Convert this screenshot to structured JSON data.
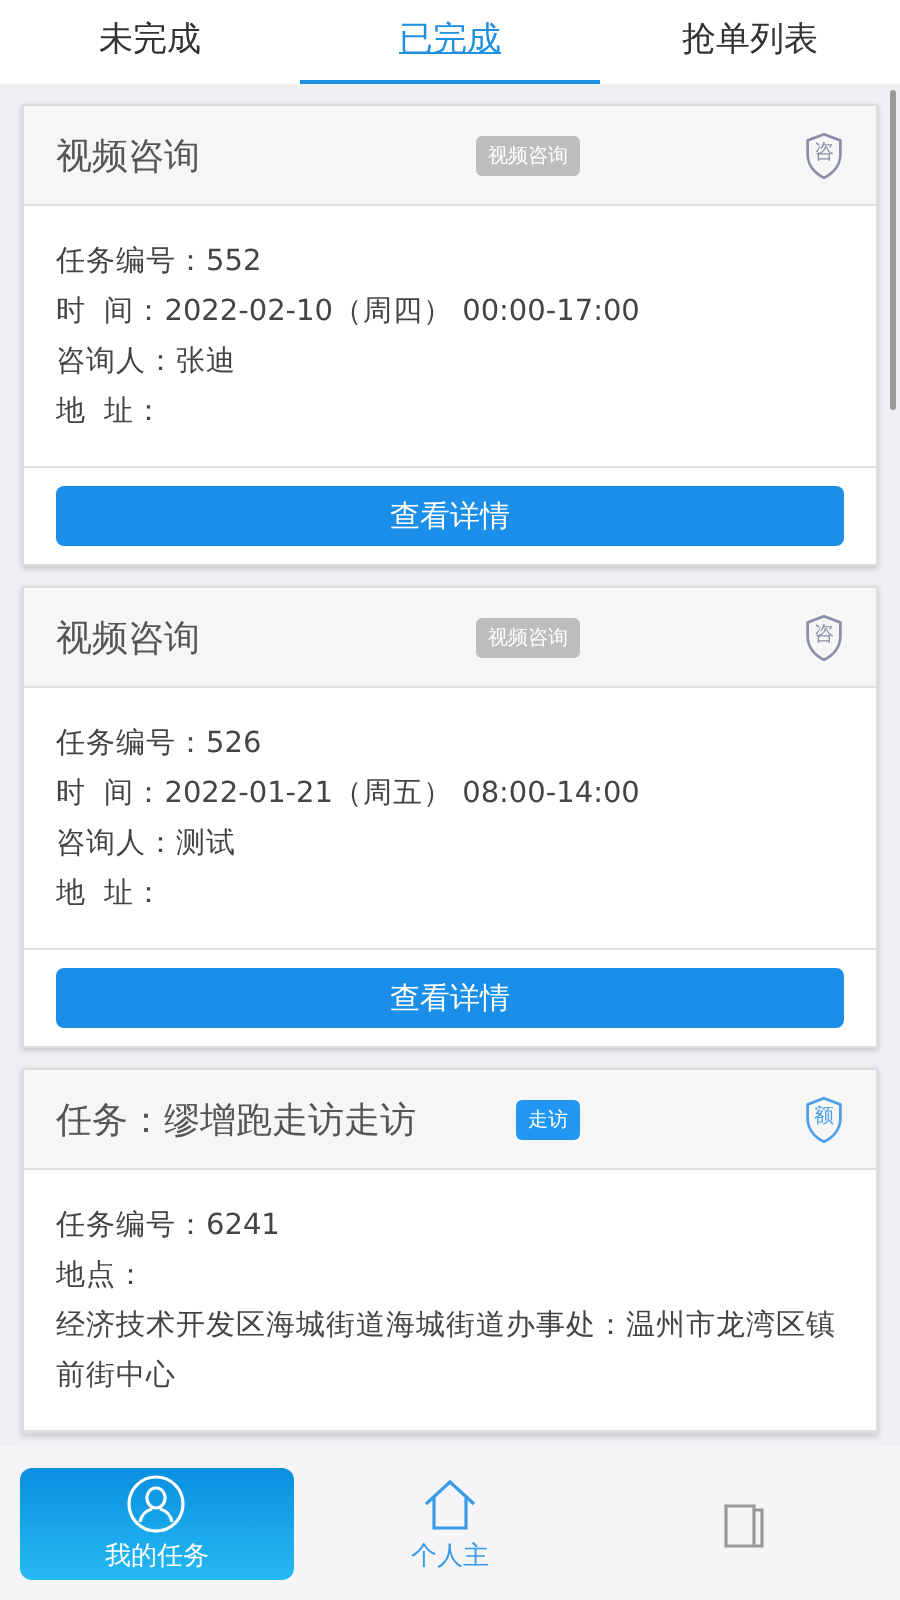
{
  "tabs": [
    {
      "label": "未完成",
      "selected": false
    },
    {
      "label": "已完成",
      "selected": true
    },
    {
      "label": "抢单列表",
      "selected": false
    }
  ],
  "cards": [
    {
      "title": "视频咨询",
      "tag": {
        "text": "视频咨询",
        "color": "#bdbdbd"
      },
      "shield": {
        "char": "咨",
        "color": "#8a8fa8"
      },
      "lines": [
        "任务编号：552",
        "时  间：2022-02-10（周四） 00:00-17:00",
        "咨询人：张迪",
        "地  址："
      ],
      "button": "查看详情"
    },
    {
      "title": "视频咨询",
      "tag": {
        "text": "视频咨询",
        "color": "#bdbdbd"
      },
      "shield": {
        "char": "咨",
        "color": "#8a8fa8"
      },
      "lines": [
        "任务编号：526",
        "时  间：2022-01-21（周五） 08:00-14:00",
        "咨询人：测试",
        "地  址："
      ],
      "button": "查看详情"
    },
    {
      "title": "任务：缪增跑走访走访",
      "tag": {
        "text": "走访",
        "color": "#2196f3"
      },
      "shield": {
        "char": "额",
        "color": "#4a9fe8"
      },
      "lines": [
        "任务编号：6241",
        "地点：",
        "经济技术开发区海城街道海城街道办事处：温州市龙湾区镇前街中心"
      ]
    }
  ],
  "nav": [
    {
      "label": "我的任务",
      "kind": "person",
      "selected": true
    },
    {
      "label": "个人主",
      "kind": "house",
      "selected": false
    },
    {
      "kind": "other",
      "selected": false
    }
  ]
}
